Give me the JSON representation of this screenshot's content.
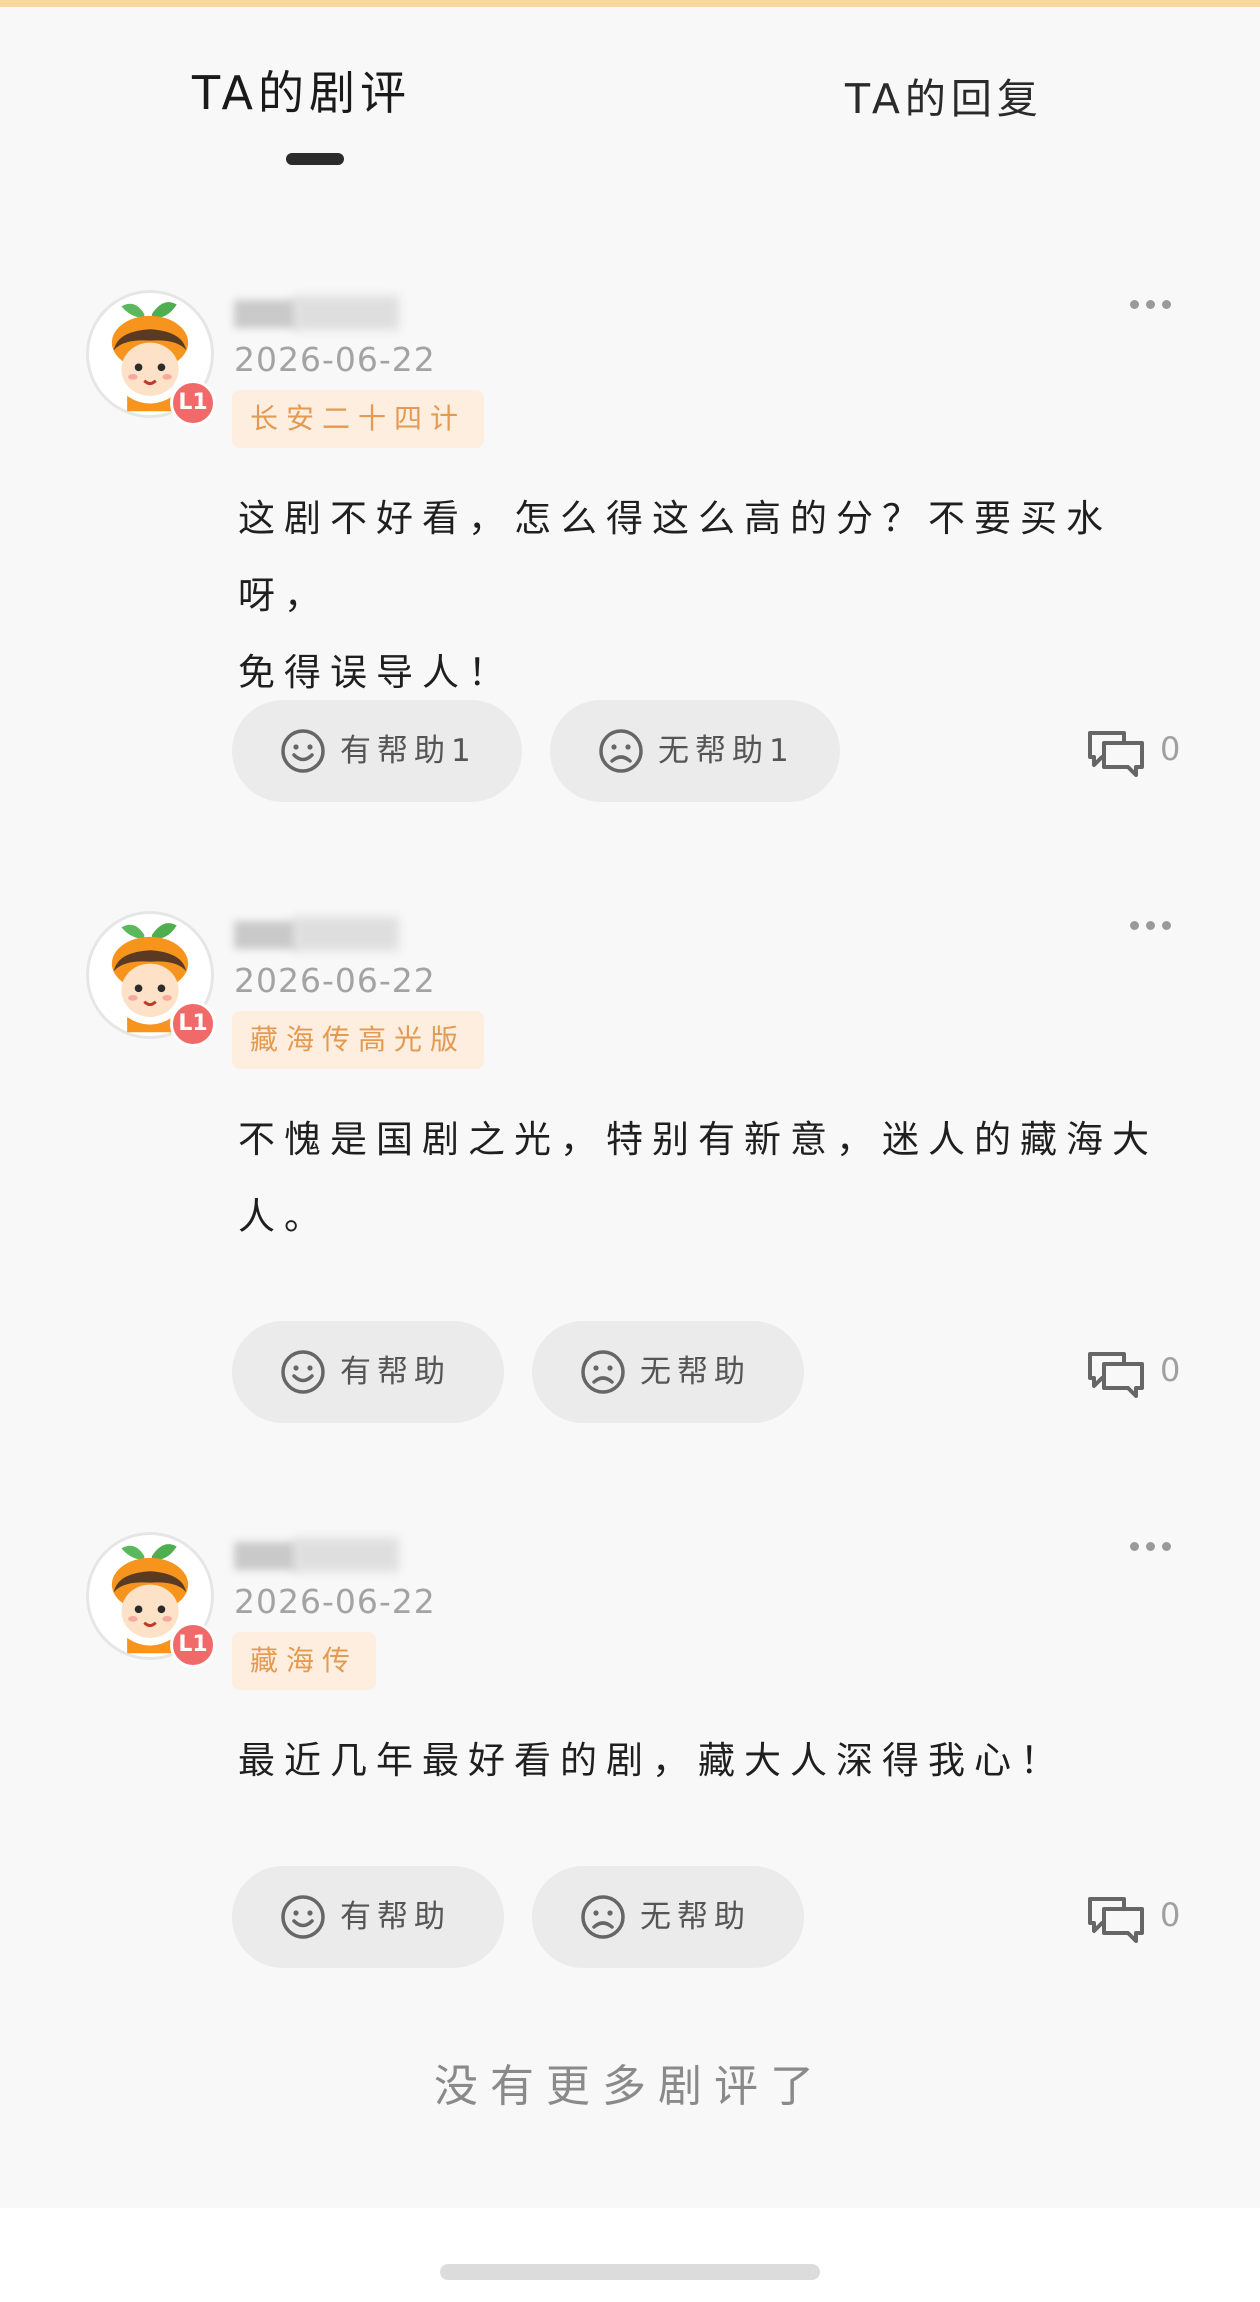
{
  "tabs": {
    "active_label": "TA的剧评",
    "inactive_label": "TA的回复"
  },
  "reviews": [
    {
      "date": "2026-06-22",
      "level": "L1",
      "drama_tag": "长安二十四计",
      "content_line1": "这剧不好看，怎么得这么高的分？不要买水呀，",
      "content_line2": "免得误导人！",
      "helpful_label": "有帮助1",
      "unhelpful_label": "无帮助1",
      "comment_count": "0"
    },
    {
      "date": "2026-06-22",
      "level": "L1",
      "drama_tag": "藏海传高光版",
      "content_line1": "不愧是国剧之光，特别有新意，迷人的藏海大",
      "content_line2": "人。",
      "helpful_label": "有帮助",
      "unhelpful_label": "无帮助",
      "comment_count": "0"
    },
    {
      "date": "2026-06-22",
      "level": "L1",
      "drama_tag": "藏海传",
      "content_line1": "最近几年最好看的剧，藏大人深得我心！",
      "content_line2": "",
      "helpful_label": "有帮助",
      "unhelpful_label": "无帮助",
      "comment_count": "0"
    }
  ],
  "footer": {
    "no_more_text": "没有更多剧评了"
  },
  "icons": {
    "more": "more-dots-icon",
    "smile": "smile-icon",
    "frown": "frown-icon",
    "comment": "comment-bubbles-icon",
    "avatar": "orange-kid-avatar"
  },
  "colors": {
    "accent_tag_bg": "#fdeedf",
    "accent_tag_text": "#e39a52",
    "level_badge": "#f06a6a",
    "top_strip": "#f9d79e"
  }
}
